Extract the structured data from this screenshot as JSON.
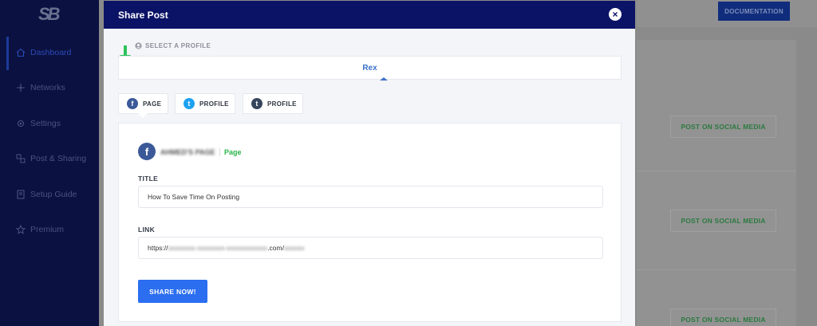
{
  "app": {
    "logo_text": "SB"
  },
  "sidebar": {
    "items": [
      {
        "label": "Dashboard",
        "icon": "home-icon"
      },
      {
        "label": "Networks",
        "icon": "network-icon"
      },
      {
        "label": "Settings",
        "icon": "gear-icon"
      },
      {
        "label": "Post & Sharing",
        "icon": "share-icon"
      },
      {
        "label": "Setup Guide",
        "icon": "book-icon"
      },
      {
        "label": "Premium",
        "icon": "star-icon"
      }
    ]
  },
  "header": {
    "documentation_label": "DOCUMENTATION"
  },
  "background": {
    "post_buttons": [
      "POST ON SOCIAL MEDIA",
      "POST ON SOCIAL MEDIA",
      "POST ON SOCIAL MEDIA"
    ]
  },
  "modal": {
    "title": "Share Post",
    "close_symbol": "×",
    "select_profile_label": "SELECT A PROFILE",
    "selected_profile": "Rex",
    "network_tabs": [
      {
        "label": "PAGE",
        "icon": "facebook-icon",
        "icon_glyph": "f",
        "color": "#3b5998"
      },
      {
        "label": "PROFILE",
        "icon": "twitter-icon",
        "icon_glyph": "t",
        "color": "#1da1f2"
      },
      {
        "label": "PROFILE",
        "icon": "tumblr-icon",
        "icon_glyph": "t",
        "color": "#35465c"
      }
    ],
    "account": {
      "name": "AHMED'S PAGE",
      "type": "Page",
      "avatar_glyph": "f"
    },
    "title_label": "TITLE",
    "title_value": "How To Save Time On Posting",
    "link_label": "LINK",
    "link_prefix": "https://",
    "link_hidden": "xxxxxxxx-xxxxxxxx-xxxxxxxxxxxx",
    "link_domain_suffix": ".com/",
    "link_path_hidden": "xxxxxx",
    "share_button_label": "SHARE NOW!"
  },
  "colors": {
    "modal_header": "#0b1367",
    "accent_blue": "#2b6ef0",
    "profile_blue": "#3d73c9",
    "success_green": "#2bb34a",
    "facebook": "#3b5998",
    "twitter": "#1da1f2",
    "tumblr": "#35465c"
  }
}
